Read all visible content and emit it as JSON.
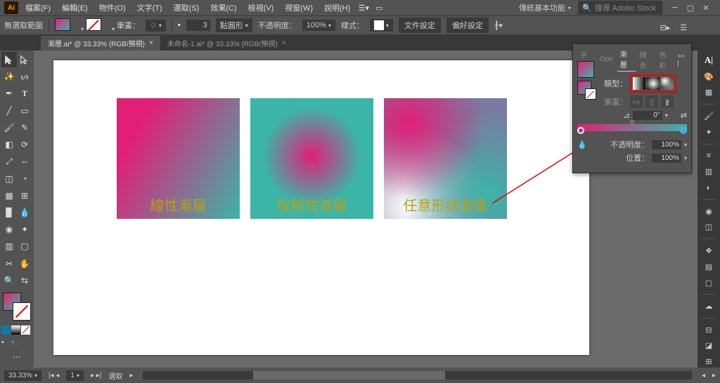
{
  "menubar": {
    "logo": "Ai",
    "items": [
      "檔案(F)",
      "編輯(E)",
      "物件(O)",
      "文字(T)",
      "選取(S)",
      "效果(C)",
      "檢視(V)",
      "視窗(W)",
      "說明(H)"
    ],
    "workspace": "傳統基本功能",
    "search_placeholder": "搜尋 Adobe Stock"
  },
  "ctrlbar": {
    "label": "無選取範圍",
    "stroke_label": "筆畫：",
    "stroke_size": "3",
    "stroke_unit": "點圓形",
    "opacity_label": "不透明度：",
    "opacity": "100%",
    "style_label": "樣式：",
    "doc_setup": "文件設定",
    "pref_setup": "偏好設定"
  },
  "tabs": [
    {
      "title": "漸層.ai* @ 33.33% (RGB/預視)",
      "active": true
    },
    {
      "title": "未命名-1.ai* @ 33.33% (RGB/預視)",
      "active": false
    }
  ],
  "squares": {
    "linear": "線性漸層",
    "radial": "放射性漸層",
    "freeform": "任意形狀漸層"
  },
  "panel": {
    "tabs": [
      "字符",
      "Ope",
      "漸層",
      "顏色",
      "色彩"
    ],
    "active_tab": "漸層",
    "type_label": "類型：",
    "stroke_label": "筆畫：",
    "angle": "0°",
    "opacity_label": "不透明度：",
    "opacity": "100%",
    "pos_label": "位置：",
    "pos": "100%",
    "arrows": ">> |"
  },
  "status": {
    "zoom": "33.33%",
    "page": "1",
    "tool": "選取"
  },
  "colors": {
    "pink": "#e11f77",
    "teal": "#3bb5a8"
  }
}
